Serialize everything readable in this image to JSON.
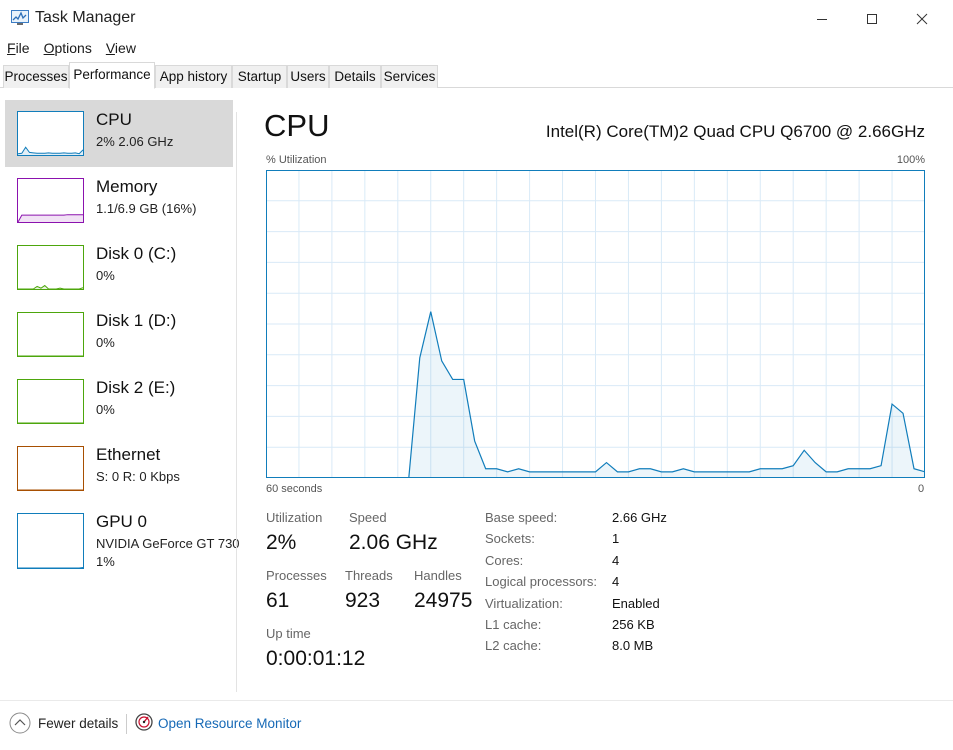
{
  "window": {
    "title": "Task Manager"
  },
  "menu": [
    {
      "label": "File",
      "key": "F",
      "rest": "ile"
    },
    {
      "label": "Options",
      "key": "O",
      "rest": "ptions"
    },
    {
      "label": "View",
      "key": "V",
      "rest": "iew"
    }
  ],
  "tabs": [
    {
      "label": "Processes",
      "active": false
    },
    {
      "label": "Performance",
      "active": true
    },
    {
      "label": "App history",
      "active": false
    },
    {
      "label": "Startup",
      "active": false
    },
    {
      "label": "Users",
      "active": false
    },
    {
      "label": "Details",
      "active": false
    },
    {
      "label": "Services",
      "active": false
    }
  ],
  "sidebar": [
    {
      "name": "CPU",
      "sub1": "2% 2.06 GHz",
      "sub2": "",
      "color": "#117dbb",
      "selected": true,
      "values": [
        3,
        4,
        18,
        6,
        5,
        4,
        4,
        4,
        5,
        4,
        4,
        4,
        5,
        4,
        4,
        5,
        3,
        12
      ]
    },
    {
      "name": "Memory",
      "sub1": "1.1/6.9 GB (16%)",
      "sub2": "",
      "color": "#8b12ae",
      "selected": false,
      "values": [
        0,
        16,
        16,
        16,
        16,
        16,
        16,
        16,
        16,
        16,
        16,
        16,
        16,
        17,
        17,
        17,
        17,
        17
      ]
    },
    {
      "name": "Disk 0 (C:)",
      "sub1": "0%",
      "sub2": "",
      "color": "#4da60c",
      "selected": false,
      "values": [
        0,
        0,
        0,
        0,
        0,
        6,
        2,
        8,
        0,
        0,
        0,
        2,
        0,
        0,
        0,
        0,
        0,
        3
      ]
    },
    {
      "name": "Disk 1 (D:)",
      "sub1": "0%",
      "sub2": "",
      "color": "#4da60c",
      "selected": false,
      "values": [
        0,
        0,
        0,
        0,
        0,
        0,
        0,
        0,
        0,
        0,
        0,
        0,
        0,
        0,
        0,
        0,
        0,
        0
      ]
    },
    {
      "name": "Disk 2 (E:)",
      "sub1": "0%",
      "sub2": "",
      "color": "#4da60c",
      "selected": false,
      "values": [
        0,
        0,
        0,
        0,
        0,
        0,
        0,
        0,
        0,
        0,
        0,
        0,
        0,
        0,
        0,
        0,
        0,
        0
      ]
    },
    {
      "name": "Ethernet",
      "sub1": "S: 0 R: 0 Kbps",
      "sub2": "",
      "color": "#a74f01",
      "selected": false,
      "values": [
        0,
        0,
        0,
        0,
        0,
        0,
        0,
        0,
        0,
        0,
        0,
        0,
        0,
        0,
        0,
        0,
        0,
        0
      ]
    },
    {
      "name": "GPU 0",
      "sub1": "NVIDIA GeForce GT 730",
      "sub2": "1%",
      "color": "#117dbb",
      "selected": false,
      "values": [
        0,
        0,
        0,
        0,
        0,
        0,
        0,
        0,
        0,
        0,
        0,
        0,
        0,
        0,
        0,
        0,
        0,
        1
      ]
    }
  ],
  "main": {
    "title": "CPU",
    "model": "Intel(R) Core(TM)2 Quad CPU Q6700 @ 2.66GHz",
    "y_label": "% Utilization",
    "y_max_label": "100%",
    "x_left_label": "60 seconds",
    "x_right_label": "0",
    "color": "#117dbb"
  },
  "chart_data": {
    "type": "area",
    "title": "",
    "xlabel": "60 seconds",
    "ylabel": "% Utilization",
    "xlim": [
      60,
      0
    ],
    "ylim": [
      0,
      100
    ],
    "grid": true,
    "x": [
      60,
      59,
      58,
      57,
      56,
      55,
      54,
      53,
      52,
      51,
      50,
      49,
      48,
      47,
      46,
      45,
      44,
      43,
      42,
      41,
      40,
      39,
      38,
      37,
      36,
      35,
      34,
      33,
      32,
      31,
      30,
      29,
      28,
      27,
      26,
      25,
      24,
      23,
      22,
      21,
      20,
      19,
      18,
      17,
      16,
      15,
      14,
      13,
      12,
      11,
      10,
      9,
      8,
      7,
      6,
      5,
      4,
      3,
      2,
      1,
      0
    ],
    "series": [
      {
        "values": [
          0,
          0,
          0,
          0,
          0,
          0,
          0,
          0,
          0,
          0,
          0,
          0,
          0,
          0,
          39,
          54,
          38,
          32,
          32,
          12,
          3,
          3,
          2,
          3,
          2,
          2,
          2,
          2,
          2,
          2,
          2,
          5,
          2,
          2,
          3,
          3,
          2,
          2,
          3,
          2,
          2,
          2,
          2,
          2,
          2,
          3,
          3,
          3,
          4,
          9,
          5,
          2,
          2,
          3,
          3,
          3,
          4,
          24,
          21,
          3,
          2
        ]
      }
    ]
  },
  "stats": {
    "utilization_label": "Utilization",
    "utilization_value": "2%",
    "speed_label": "Speed",
    "speed_value": "2.06 GHz",
    "processes_label": "Processes",
    "processes_value": "61",
    "threads_label": "Threads",
    "threads_value": "923",
    "handles_label": "Handles",
    "handles_value": "24975",
    "uptime_label": "Up time",
    "uptime_value": "0:00:01:12"
  },
  "specs": [
    {
      "label": "Base speed:",
      "value": "2.66 GHz"
    },
    {
      "label": "Sockets:",
      "value": "1"
    },
    {
      "label": "Cores:",
      "value": "4"
    },
    {
      "label": "Logical processors:",
      "value": "4"
    },
    {
      "label": "Virtualization:",
      "value": "Enabled"
    },
    {
      "label": "L1 cache:",
      "value": "256 KB"
    },
    {
      "label": "L2 cache:",
      "value": "8.0 MB"
    }
  ],
  "footer": {
    "fewer_details": "Fewer details",
    "resource_monitor": "Open Resource Monitor"
  }
}
